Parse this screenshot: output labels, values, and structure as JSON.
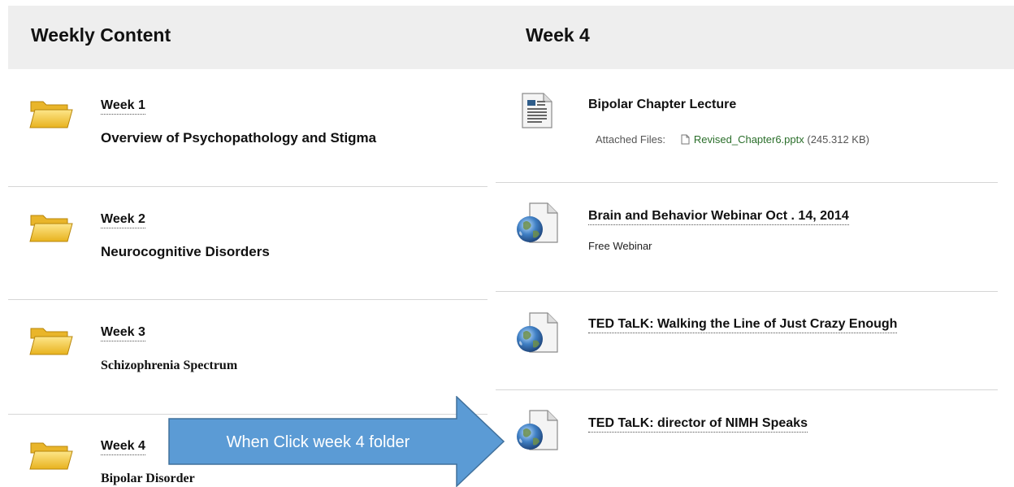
{
  "left_panel": {
    "title": "Weekly Content",
    "folders": [
      {
        "label": "Week 1",
        "description": "Overview of Psychopathology and Stigma"
      },
      {
        "label": "Week 2",
        "description": "Neurocognitive Disorders"
      },
      {
        "label": "Week 3",
        "description": "Schizophrenia Spectrum"
      },
      {
        "label": "Week 4",
        "description": "Bipolar Disorder"
      }
    ]
  },
  "right_panel": {
    "title": "Week 4",
    "items": [
      {
        "title": "Bipolar Chapter Lecture",
        "icon": "document-icon",
        "attached_label": "Attached Files:",
        "file_name": "Revised_Chapter6.pptx",
        "file_size": "(245.312 KB)"
      },
      {
        "title": "Brain and Behavior Webinar Oct . 14, 2014",
        "icon": "globe-icon",
        "description": "Free Webinar"
      },
      {
        "title": "TED TaLK: Walking the Line of Just Crazy Enough",
        "icon": "globe-icon"
      },
      {
        "title": "TED TaLK: director of NIMH Speaks",
        "icon": "globe-icon"
      }
    ]
  },
  "callout": {
    "text": "When Click week 4 folder",
    "color": "#5b9bd5"
  },
  "colors": {
    "header_bg": "#eeeeee",
    "folder": "#f5c542",
    "file_link": "#2a6e2a"
  }
}
